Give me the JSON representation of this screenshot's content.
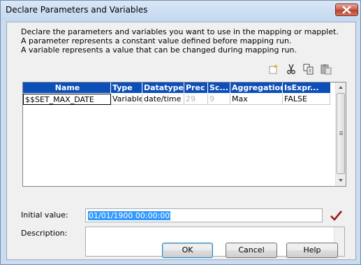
{
  "window": {
    "title": "Declare Parameters and Variables"
  },
  "intro": {
    "lines": [
      "Declare the parameters and variables you want to use in the mapping or mapplet.",
      "A parameter represents a constant value defined before mapping run.",
      "A variable represents a value that can be changed during mapping run."
    ]
  },
  "toolbar": [
    "new-icon",
    "cut-icon",
    "copy-icon",
    "paste-icon"
  ],
  "grid": {
    "columns": [
      "Name",
      "Type",
      "Datatype",
      "Prec",
      "Sc...",
      "Aggregation",
      "IsExpr..."
    ],
    "rows": [
      {
        "name": "$$SET_MAX_DATE",
        "type": "Variable",
        "datatype": "date/time",
        "prec": "29",
        "scale": "9",
        "aggregation": "Max",
        "isexpr": "FALSE"
      }
    ]
  },
  "initial_value": {
    "label": "Initial value:",
    "value": "01/01/1900 00:00:00"
  },
  "description": {
    "label": "Description:",
    "value": ""
  },
  "buttons": {
    "ok": "OK",
    "cancel": "Cancel",
    "help": "Help"
  },
  "colors": {
    "header_bg": "#0d4fb8",
    "selection": "#3399ff",
    "check": "#9b1c1c"
  }
}
